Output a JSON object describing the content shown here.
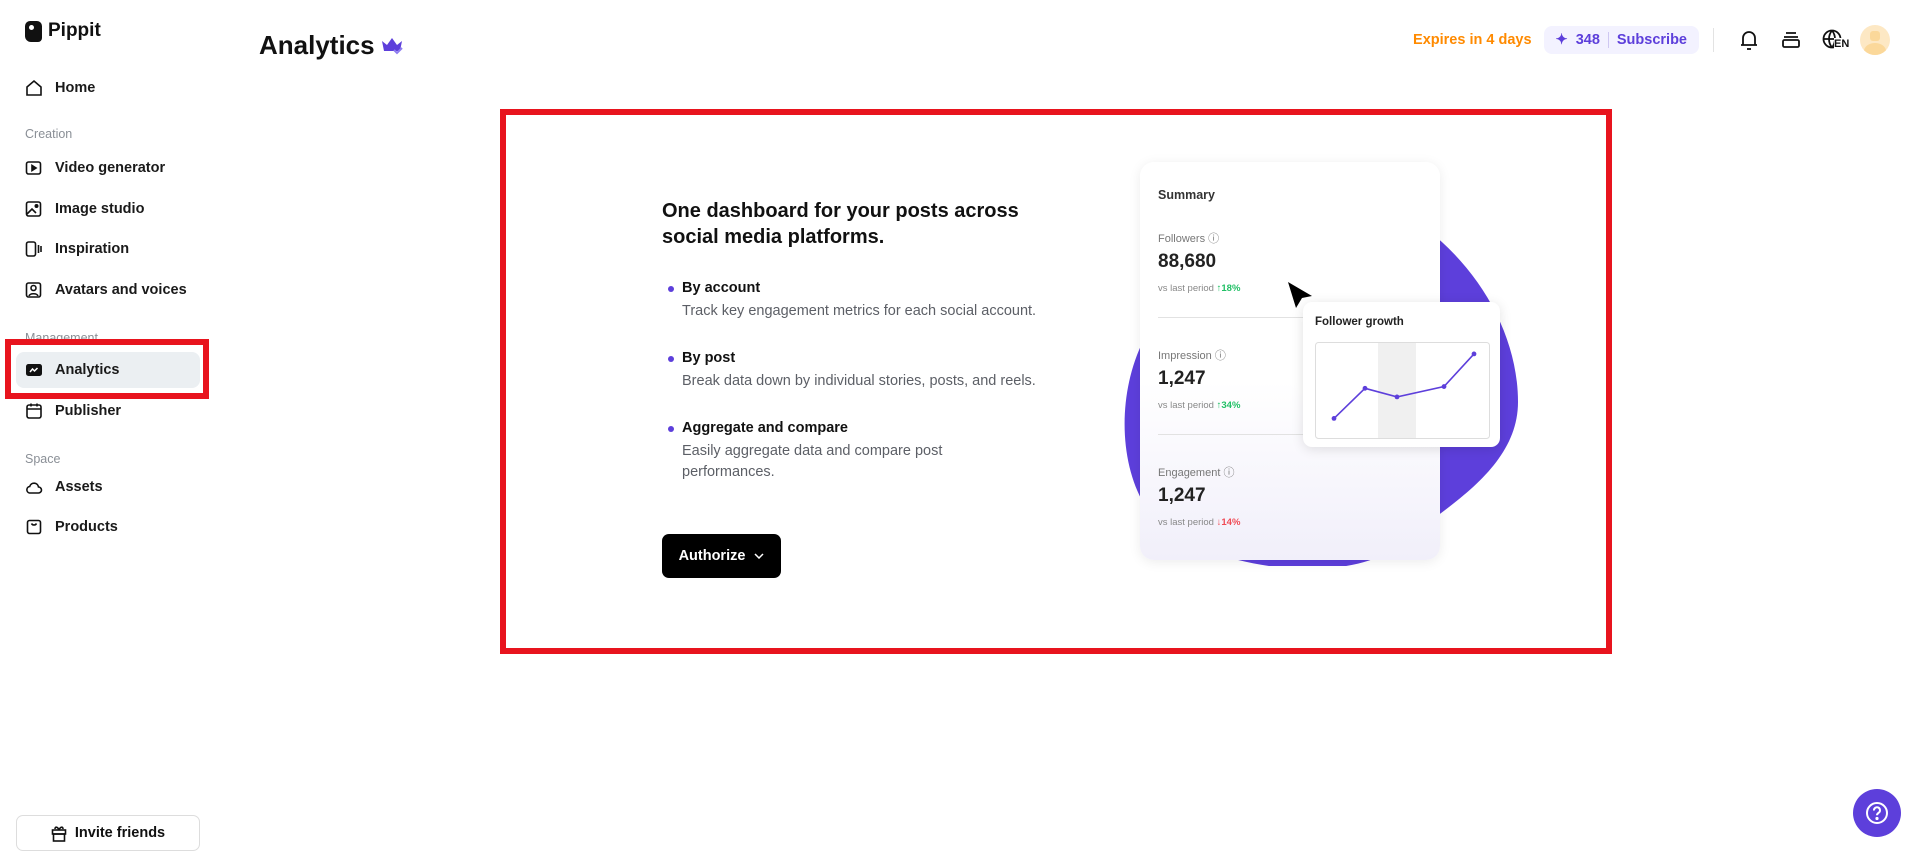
{
  "brand": "Pippit",
  "sidebar": {
    "home": "Home",
    "sections": {
      "creation": "Creation",
      "management": "Management",
      "space": "Space"
    },
    "items": {
      "video": "Video generator",
      "image": "Image studio",
      "inspiration": "Inspiration",
      "avatars": "Avatars and voices",
      "analytics": "Analytics",
      "publisher": "Publisher",
      "assets": "Assets",
      "products": "Products"
    },
    "invite": "Invite friends"
  },
  "header": {
    "title": "Analytics",
    "expires": "Expires in 4 days",
    "credits": "348",
    "subscribe": "Subscribe",
    "language": "EN"
  },
  "main": {
    "heading": "One dashboard for your posts across social media platforms.",
    "features": [
      {
        "title": "By account",
        "desc": "Track key engagement metrics for each social account."
      },
      {
        "title": "By post",
        "desc": "Break data down by individual stories, posts, and reels."
      },
      {
        "title": "Aggregate and compare",
        "desc": "Easily aggregate data and compare post performances."
      }
    ],
    "authorize": "Authorize"
  },
  "illustration": {
    "summary": "Summary",
    "metrics": [
      {
        "label": "Followers",
        "value": "88,680",
        "vs": "vs last period",
        "change": "↑18%"
      },
      {
        "label": "Impression",
        "value": "1,247",
        "vs": "vs last period",
        "change": "↑34%"
      },
      {
        "label": "Engagement",
        "value": "1,247",
        "vs": "vs last period",
        "change": "↓14%"
      }
    ],
    "growth_title": "Follower growth",
    "growth_points": [
      1,
      4.5,
      3.5,
      4.7,
      8.5
    ]
  },
  "colors": {
    "accent": "#5d3fdb",
    "highlight": "#e8141e",
    "warning": "#ff8a00"
  }
}
